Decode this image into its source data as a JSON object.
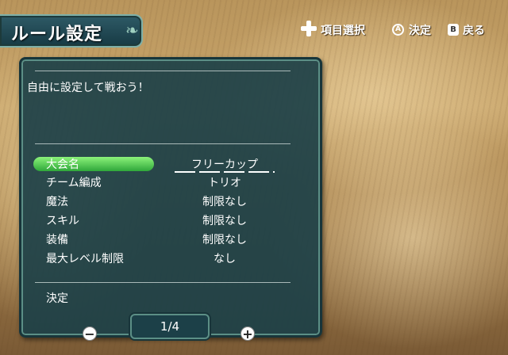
{
  "header": {
    "title": "ルール設定"
  },
  "hints": {
    "select": "項目選択",
    "confirm": "決定",
    "back": "戻る",
    "a_glyph": "A",
    "b_glyph": "B"
  },
  "panel": {
    "description": "自由に設定して戦おう！",
    "rows": [
      {
        "label": "大会名",
        "value": "フリーカップ"
      },
      {
        "label": "チーム編成",
        "value": "トリオ"
      },
      {
        "label": "魔法",
        "value": "制限なし"
      },
      {
        "label": "スキル",
        "value": "制限なし"
      },
      {
        "label": "装備",
        "value": "制限なし"
      },
      {
        "label": "最大レベル制限",
        "value": "なし"
      }
    ],
    "confirm_label": "決定"
  },
  "pager": {
    "text": "1/4",
    "prev_glyph": "−",
    "next_glyph": "+"
  }
}
